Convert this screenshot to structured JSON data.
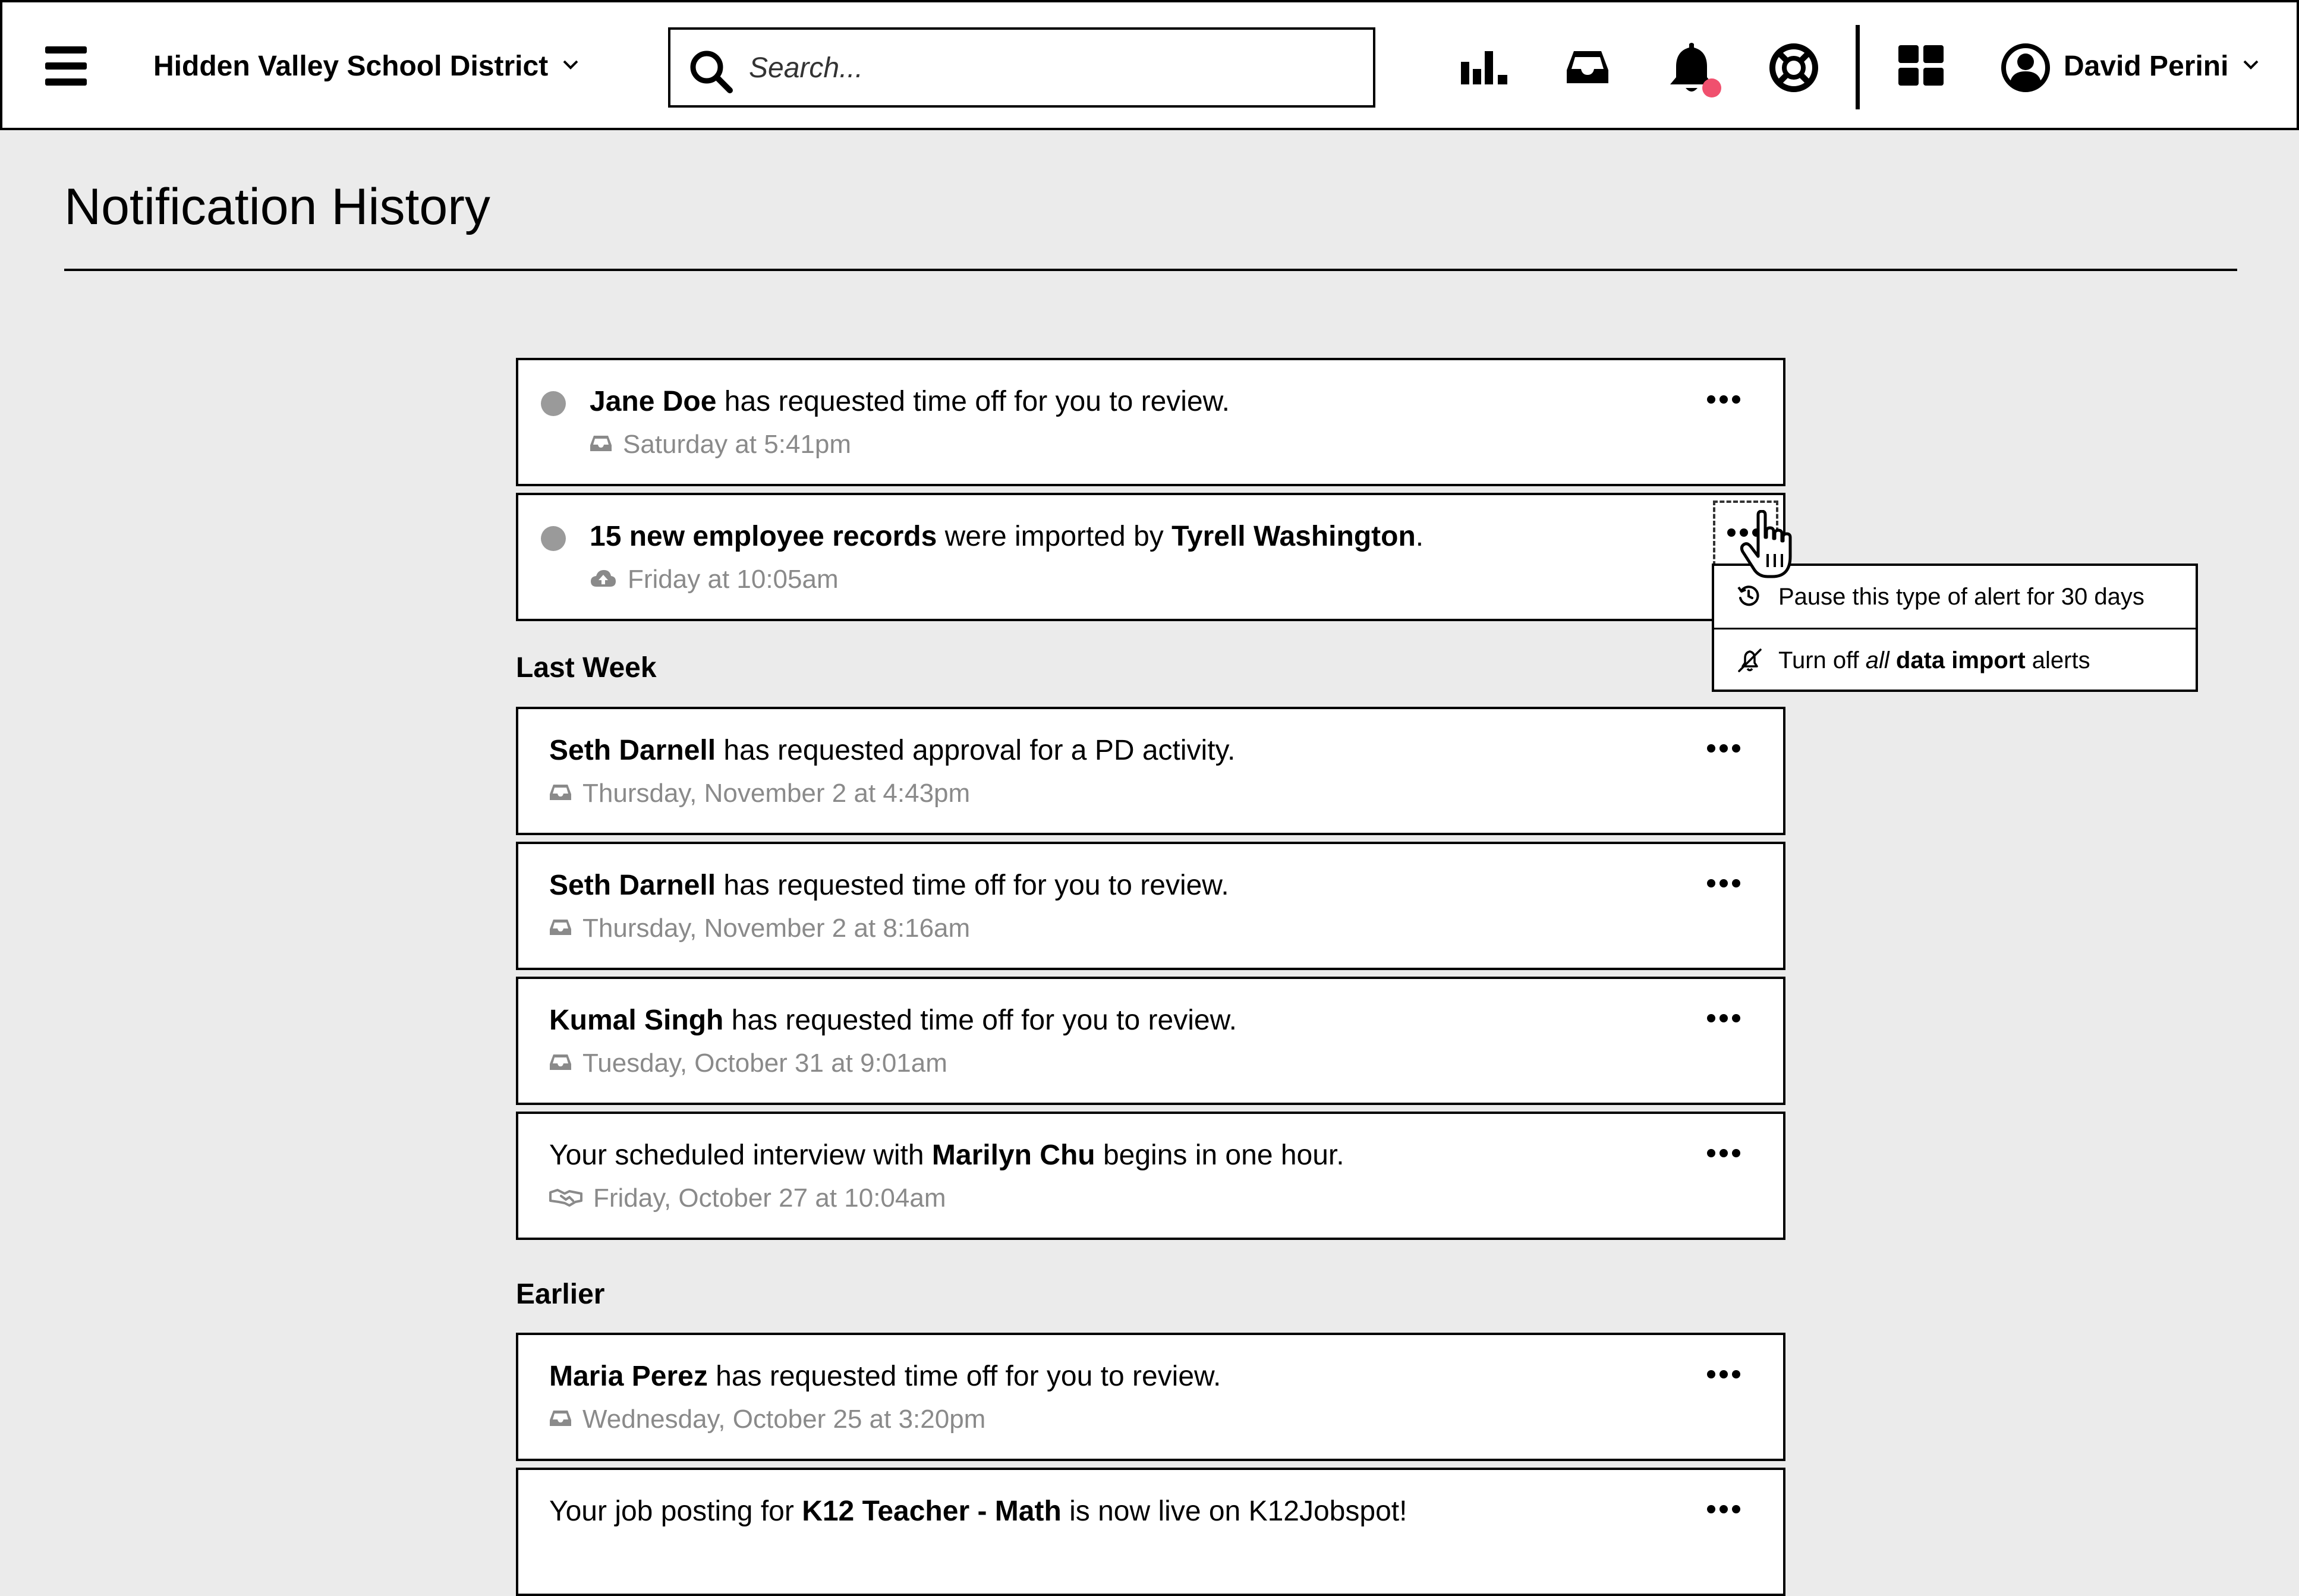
{
  "header": {
    "district": "Hidden Valley School District",
    "search_placeholder": "Search...",
    "user_name": "David Perini"
  },
  "page": {
    "title": "Notification History"
  },
  "sections": {
    "last_week": "Last Week",
    "earlier": "Earlier"
  },
  "notifications": [
    {
      "bold_1": "Jane Doe",
      "text_1": " has requested time off for you to review.",
      "time": "Saturday at 5:41pm",
      "icon": "inbox-icon",
      "unread": true
    },
    {
      "bold_1": "15 new employee records",
      "text_1": " were imported by ",
      "bold_2": "Tyrell Washington",
      "text_2": ".",
      "time": "Friday at 10:05am",
      "icon": "cloud-upload-icon",
      "unread": true
    },
    {
      "bold_1": "Seth Darnell",
      "text_1": " has requested approval for a PD activity.",
      "time": "Thursday, November 2 at 4:43pm",
      "icon": "inbox-icon",
      "unread": false
    },
    {
      "bold_1": "Seth Darnell",
      "text_1": " has requested time off for you to review.",
      "time": "Thursday, November 2 at 8:16am",
      "icon": "inbox-icon",
      "unread": false
    },
    {
      "bold_1": "Kumal Singh",
      "text_1": " has requested time off for you to review.",
      "time": "Tuesday, October 31 at 9:01am",
      "icon": "inbox-icon",
      "unread": false
    },
    {
      "text_0": "Your scheduled interview with ",
      "bold_1": "Marilyn Chu",
      "text_1": " begins in one hour.",
      "time": "Friday, October 27 at 10:04am",
      "icon": "handshake-icon",
      "unread": false
    },
    {
      "bold_1": "Maria Perez",
      "text_1": " has requested time off for you to review.",
      "time": "Wednesday, October 25 at 3:20pm",
      "icon": "inbox-icon",
      "unread": false
    },
    {
      "text_0": "Your job posting for ",
      "bold_1": "K12 Teacher - Math",
      "text_1": " is now live on K12Jobspot!",
      "unread": false
    }
  ],
  "menu": {
    "pause": "Pause this type of alert for 30 days",
    "turn_off_1": "Turn off ",
    "turn_off_2": "all",
    "turn_off_3": " data import",
    "turn_off_4": " alerts"
  },
  "colors": {
    "background": "#ebebeb",
    "notification_badge": "#f0506e",
    "unread_dot": "#9a9a9a",
    "meta_text": "#8a8a8a"
  }
}
